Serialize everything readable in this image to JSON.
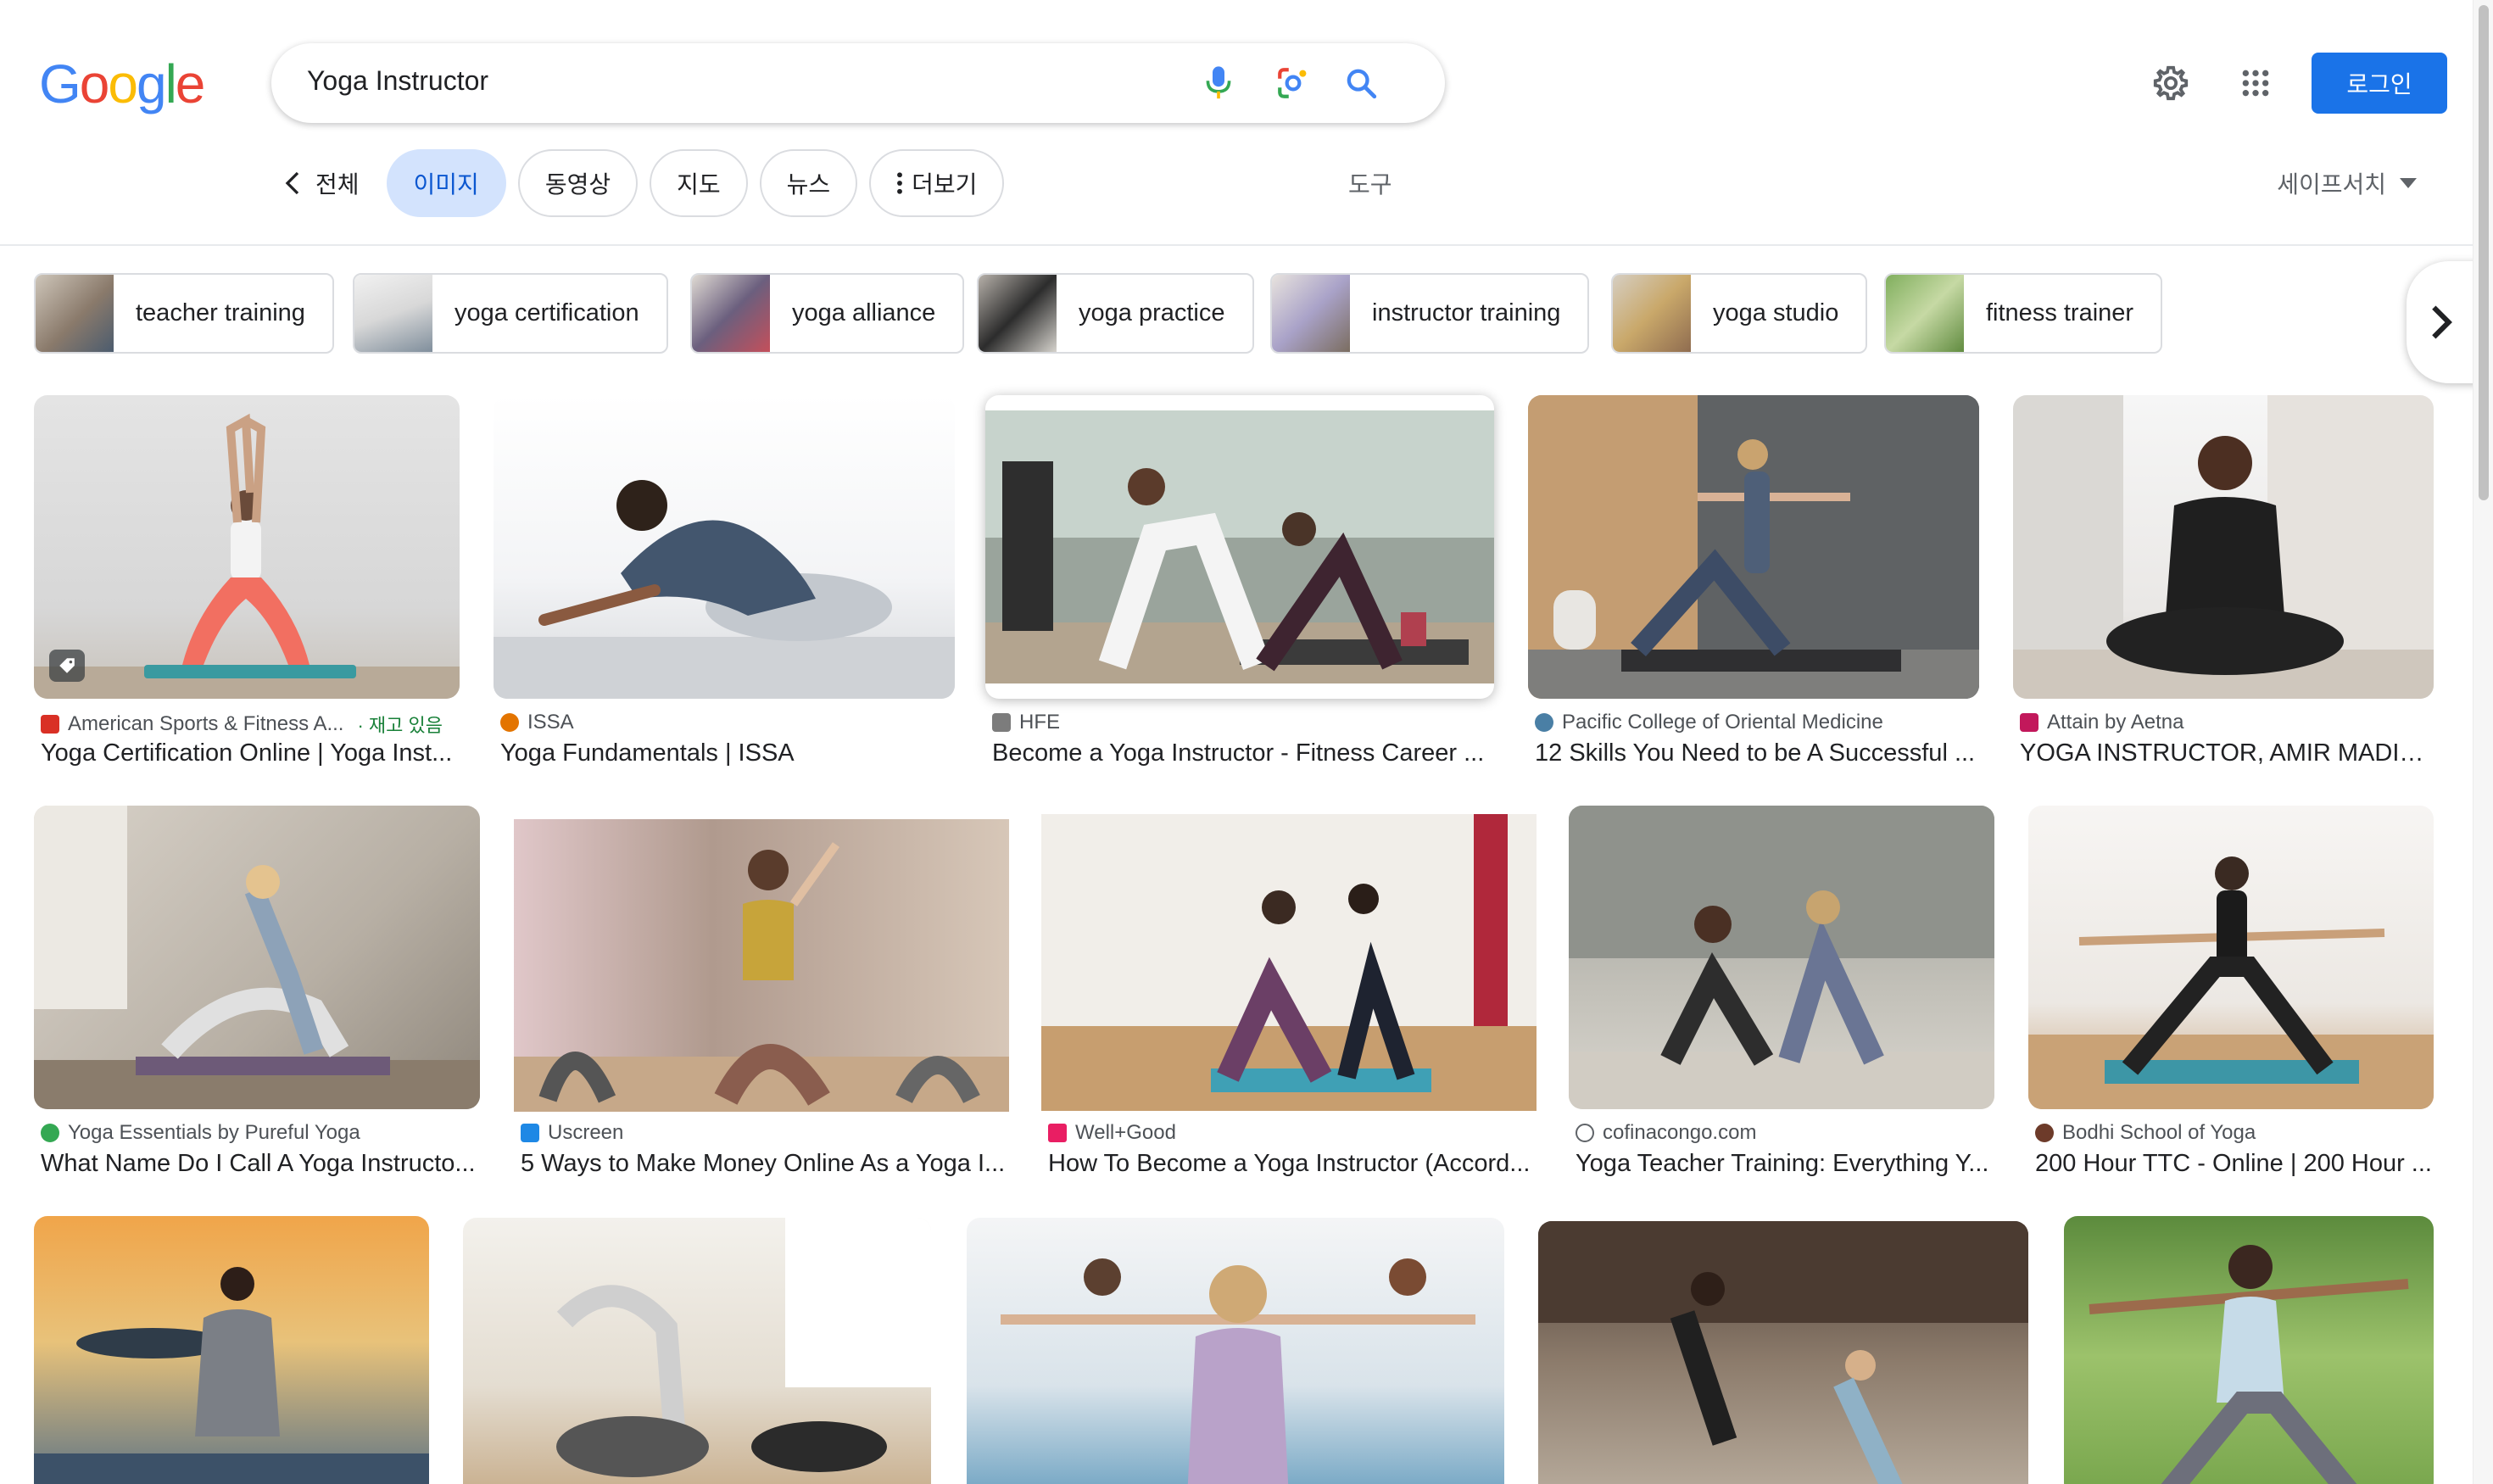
{
  "header": {
    "logo_letters": [
      "G",
      "o",
      "o",
      "g",
      "l",
      "e"
    ],
    "logo_colors": [
      "#4285F4",
      "#EA4335",
      "#FBBC05",
      "#4285F4",
      "#34A853",
      "#EA4335"
    ],
    "search_value": "Yoga Instructor",
    "icons": [
      "mic-icon",
      "lens-icon",
      "search-icon"
    ],
    "settings_icon": "gear-icon",
    "apps_icon": "apps-grid-icon",
    "login_label": "로그인",
    "accent": "#1a73e8"
  },
  "tabs": {
    "back_label": "전체",
    "items": [
      "이미지",
      "동영상",
      "지도",
      "뉴스"
    ],
    "more_label": "더보기",
    "active": "이미지",
    "tools_label": "도구",
    "safesearch_label": "세이프서치"
  },
  "chips": [
    {
      "label": "teacher training"
    },
    {
      "label": "yoga certification"
    },
    {
      "label": "yoga alliance"
    },
    {
      "label": "yoga practice"
    },
    {
      "label": "instructor training"
    },
    {
      "label": "yoga studio"
    },
    {
      "label": "fitness trainer"
    }
  ],
  "results": [
    {
      "source": "American Sports & Fitness A...",
      "stock": "· 재고 있음",
      "title": "Yoga Certification Online | Yoga Inst..."
    },
    {
      "source": "ISSA",
      "title": "Yoga Fundamentals | ISSA"
    },
    {
      "source": "HFE",
      "title": "Become a Yoga Instructor - Fitness Career ..."
    },
    {
      "source": "Pacific College of Oriental Medicine",
      "title": "12 Skills You Need to be A Successful ..."
    },
    {
      "source": "Attain by Aetna",
      "title": "YOGA INSTRUCTOR, AMIR MADISO..."
    },
    {
      "source": "Yoga Essentials by Pureful Yoga",
      "title": "What Name Do I Call A Yoga Instructo..."
    },
    {
      "source": "Uscreen",
      "title": "5 Ways to Make Money Online As a Yoga I..."
    },
    {
      "source": "Well+Good",
      "title": "How To Become a Yoga Instructor (Accord..."
    },
    {
      "source": "cofinacongo.com",
      "title": "Yoga Teacher Training: Everything Y..."
    },
    {
      "source": "Bodhi School of Yoga",
      "title": "200 Hour TTC - Online | 200 Hour ..."
    }
  ]
}
